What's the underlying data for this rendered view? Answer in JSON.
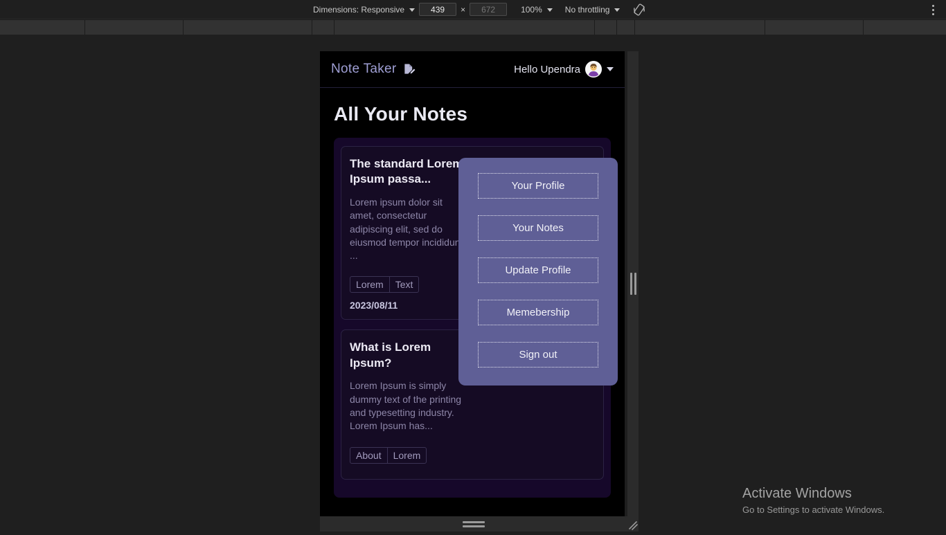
{
  "devtools": {
    "dimensions_label": "Dimensions: Responsive",
    "width_value": "439",
    "height_placeholder": "672",
    "zoom_label": "100%",
    "throttling_label": "No throttling",
    "rotate_icon": "rotate-device-icon",
    "more_icon": "more-options-icon",
    "ruler_ticks": [
      122,
      264,
      450,
      482,
      858,
      890,
      916,
      1104,
      1246
    ]
  },
  "app": {
    "header": {
      "brand": "Note Taker",
      "brand_icon": "note-pencil-icon",
      "greeting": "Hello Upendra",
      "avatar_icon": "user-avatar-icon",
      "caret_icon": "chevron-down-icon"
    },
    "page_title": "All Your Notes",
    "notes": [
      {
        "title": "The standard Lorem Ipsum passa...",
        "body": "Lorem ipsum dolor sit amet, consectetur adipiscing elit, sed do eiusmod tempor incididunt ...",
        "tags": [
          "Lorem",
          "Text"
        ],
        "date": "2023/08/11"
      },
      {
        "title": "What is Lorem Ipsum?",
        "body": "Lorem Ipsum is simply dummy text of the printing and typesetting industry. Lorem Ipsum has...",
        "tags": [
          "About",
          "Lorem"
        ],
        "date": ""
      }
    ],
    "user_menu": {
      "items": [
        "Your Profile",
        "Your Notes",
        "Update Profile",
        "Memebership",
        "Sign out"
      ]
    }
  },
  "watermark": {
    "title": "Activate Windows",
    "subtitle": "Go to Settings to activate Windows."
  },
  "colors": {
    "menu_bg": "#5f5f96",
    "brand_text": "#9f9fd4",
    "app_bg": "#000000",
    "notes_container": "#16082a",
    "note_card": "#150b24"
  }
}
